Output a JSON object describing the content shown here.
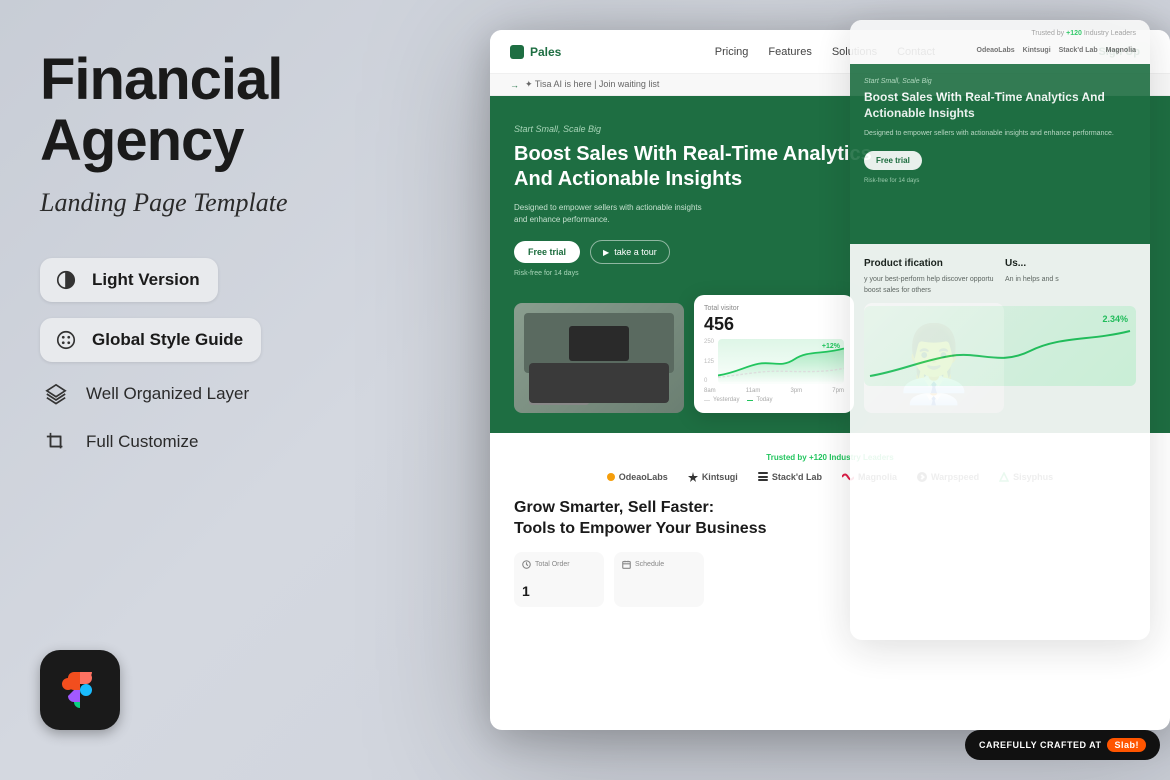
{
  "page": {
    "bg_color": "#d1d5db"
  },
  "left": {
    "title": "Financial\nAgency",
    "subtitle": "Landing Page Template",
    "features": [
      {
        "id": "light-version",
        "label": "Light Version",
        "icon": "circle-half"
      },
      {
        "id": "global-style-guide",
        "label": "Global Style Guide",
        "icon": "palette-circle"
      },
      {
        "id": "well-organized-layer",
        "label": "Well Organized Layer",
        "icon": "layers"
      },
      {
        "id": "full-customize",
        "label": "Full Customize",
        "icon": "crop"
      }
    ]
  },
  "nav": {
    "logo": "Pales",
    "links": [
      "Pricing",
      "Features",
      "Solutions",
      "Contact"
    ],
    "announce": "✦ Tisa AI is here | Join waiting list",
    "cta": "Sign Up"
  },
  "hero": {
    "small_text": "Start Small, Scale Big",
    "title": "Boost Sales With Real-Time Analytics\nAnd Actionable Insights",
    "desc": "Designed to empower sellers with actionable insights\nand enhance performance.",
    "btn_trial": "Free trial",
    "btn_tour": "take a tour",
    "risk_free": "Risk-free for 14 days"
  },
  "chart": {
    "label": "Total visitor",
    "value": "456",
    "change": "+12%",
    "ticks": [
      "8am",
      "11am",
      "3pm",
      "7pm"
    ],
    "legend_yesterday": "Yesterday",
    "legend_today": "Today",
    "y_labels": [
      "250",
      "125",
      "0"
    ]
  },
  "trusted": {
    "label": "Trusted by",
    "count": "+120",
    "suffix": "Industry Leaders",
    "logos": [
      "OdeaoLabs",
      "Kintsugi",
      "Stack'd Lab",
      "Magnolia",
      "Warpspeed",
      "Sisyphus"
    ]
  },
  "grow": {
    "title": "Grow Smarter, Sell Faster:\nTools to Empower Your Business",
    "cards": [
      {
        "label": "Total Order",
        "value": "1"
      }
    ]
  },
  "bw2": {
    "product_title": "Product\nification",
    "product_desc": "y your best-perform\nhelp discover opportu\nboost sales for others",
    "user_title": "Us...",
    "user_desc": "An in\nhelps\nand s",
    "percent": "2.34%",
    "logos": [
      "OdeaoLabs",
      "Kintsugi",
      "Stack'd Lab",
      "Magnolia"
    ]
  },
  "badge": {
    "text": "CAREFULLY CRAFTED AT",
    "brand": "Slab!"
  },
  "figma": {
    "icon": "figma"
  }
}
